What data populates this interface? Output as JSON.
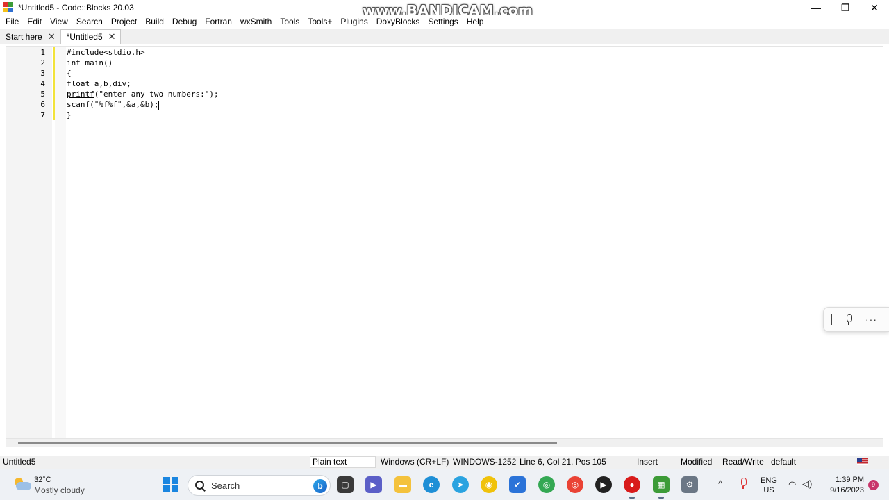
{
  "window": {
    "title": "*Untitled5 - Code::Blocks 20.03",
    "watermark": "www.BANDICAM.com",
    "minimize": "—",
    "maximize": "❐",
    "close": "✕"
  },
  "menu": [
    "File",
    "Edit",
    "View",
    "Search",
    "Project",
    "Build",
    "Debug",
    "Fortran",
    "wxSmith",
    "Tools",
    "Tools+",
    "Plugins",
    "DoxyBlocks",
    "Settings",
    "Help"
  ],
  "tabs": [
    {
      "label": "Start here",
      "close": "✕"
    },
    {
      "label": "*Untitled5",
      "close": "✕"
    }
  ],
  "editor": {
    "line_numbers": [
      "1",
      "2",
      "3",
      "4",
      "5",
      "6",
      "7"
    ],
    "lines": [
      {
        "pre": "#include<stdio.h>",
        "u": "",
        "post": ""
      },
      {
        "pre": "int main()",
        "u": "",
        "post": ""
      },
      {
        "pre": "{",
        "u": "",
        "post": ""
      },
      {
        "pre": "float a,b,div;",
        "u": "",
        "post": ""
      },
      {
        "pre": "",
        "u": "printf",
        "post": "(\"enter any two numbers:\");"
      },
      {
        "pre": "",
        "u": "scanf",
        "post": "(\"%f%f\",&a,&b);"
      },
      {
        "pre": "}",
        "u": "",
        "post": ""
      }
    ]
  },
  "status": {
    "file": "Untitled5",
    "language": "Plain text",
    "line_endings": "Windows (CR+LF)",
    "encoding": "WINDOWS-1252",
    "position": "Line 6, Col 21, Pos 105",
    "mode": "Insert",
    "modified": "Modified",
    "access": "Read/Write",
    "profile": "default"
  },
  "voice_widget": {
    "more": "···"
  },
  "taskbar": {
    "temperature": "32°C",
    "weather": "Mostly cloudy",
    "search_label": "Search",
    "bing_letter": "b",
    "lang_line1": "ENG",
    "lang_line2": "US",
    "time": "1:39 PM",
    "date": "9/16/2023",
    "notification_count": "9",
    "chevron": "^",
    "wifi": "◠",
    "volume": "◁)",
    "apps": [
      {
        "name": "task-view",
        "color": "#3a3a3a",
        "glyph": "▢"
      },
      {
        "name": "teams",
        "color": "#5b5fc7",
        "glyph": "▶"
      },
      {
        "name": "file-explorer",
        "color": "#f4c23c",
        "glyph": "▬"
      },
      {
        "name": "edge",
        "color": "#1e8fd6",
        "glyph": "e"
      },
      {
        "name": "telegram",
        "color": "#2aa3e0",
        "glyph": "➤"
      },
      {
        "name": "app-yellow",
        "color": "#f0c20a",
        "glyph": "◉"
      },
      {
        "name": "todo",
        "color": "#2b73d8",
        "glyph": "✔"
      },
      {
        "name": "chrome-1",
        "color": "#34a853",
        "glyph": "◎"
      },
      {
        "name": "chrome-2",
        "color": "#ea4335",
        "glyph": "◎"
      },
      {
        "name": "media-player",
        "color": "#222222",
        "glyph": "▶"
      },
      {
        "name": "bandicam",
        "color": "#d81b1b",
        "glyph": "●"
      },
      {
        "name": "codeblocks",
        "color": "#3c9b37",
        "glyph": "▦"
      },
      {
        "name": "settings",
        "color": "#6b7785",
        "glyph": "⚙"
      }
    ]
  }
}
